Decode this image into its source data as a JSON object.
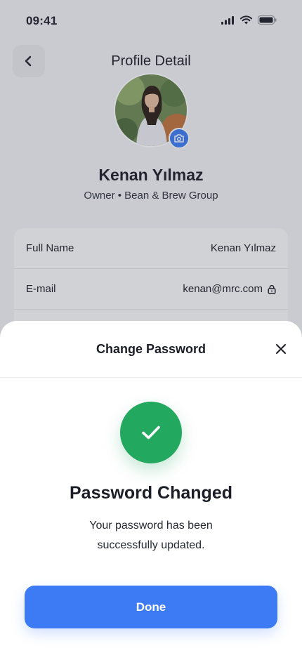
{
  "status_bar": {
    "time": "09:41"
  },
  "header": {
    "title": "Profile Detail"
  },
  "profile": {
    "name": "Kenan Yılmaz",
    "role": "Owner • Bean & Brew Group"
  },
  "info": {
    "rows": [
      {
        "label": "Full Name",
        "value": "Kenan Yılmaz",
        "locked": false
      },
      {
        "label": "E-mail",
        "value": "kenan@mrc.com",
        "locked": true
      }
    ]
  },
  "sheet": {
    "title": "Change Password",
    "success_title": "Password Changed",
    "success_message": "Your password has been successfully updated.",
    "done_label": "Done"
  },
  "colors": {
    "accent": "#3d7bf5",
    "success": "#22a85f"
  },
  "icons": {
    "back": "chevron-left-icon",
    "camera": "camera-icon",
    "lock": "lock-icon",
    "close": "close-icon",
    "check": "check-icon"
  }
}
